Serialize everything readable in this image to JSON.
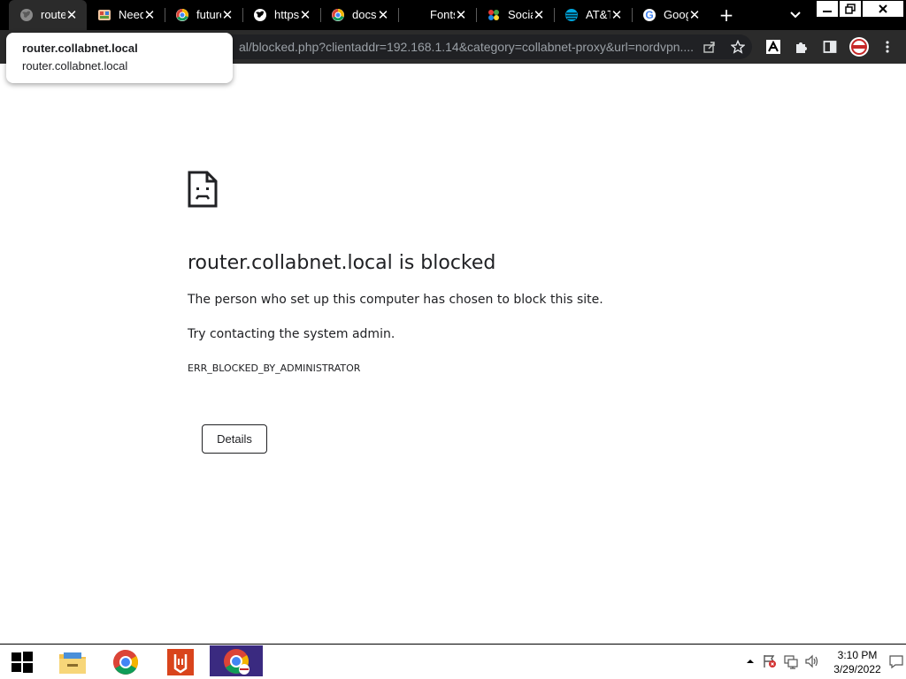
{
  "tabs": [
    {
      "label": "router.collabnet.local",
      "favicon": "globe-icon",
      "active": true
    },
    {
      "label": "Needs",
      "favicon": "gallery-icon"
    },
    {
      "label": "future",
      "favicon": "chrome-docs-icon"
    },
    {
      "label": "https",
      "favicon": "globe-icon"
    },
    {
      "label": "docs",
      "favicon": "chrome-docs-icon"
    },
    {
      "label": "Fonts",
      "favicon": "none"
    },
    {
      "label": "Social",
      "favicon": "social-icon"
    },
    {
      "label": "AT&T",
      "favicon": "att-icon"
    },
    {
      "label": "Google",
      "favicon": "google-icon"
    }
  ],
  "toolbar": {
    "url": "al/blocked.php?clientaddr=192.168.1.14&category=collabnet-proxy&url=nordvpn...."
  },
  "popup": {
    "title": "router.collabnet.local",
    "subtitle": "router.collabnet.local"
  },
  "page": {
    "title": "router.collabnet.local is blocked",
    "message": "The person who set up this computer has chosen to block this site.",
    "suggestion": "Try contacting the system admin.",
    "error_code": "ERR_BLOCKED_BY_ADMINISTRATOR",
    "details_label": "Details"
  },
  "taskbar": {
    "time": "3:10 PM",
    "date": "3/29/2022",
    "apps": [
      "file-explorer-icon",
      "chrome-icon",
      "acrobat-icon",
      "chrome-profile-icon"
    ]
  },
  "colors": {
    "tabstrip_bg": "#000000",
    "toolbar_bg": "#2b2b2b",
    "omnibox_bg": "#202124",
    "active_taskbar_app": "#3a2a80"
  }
}
